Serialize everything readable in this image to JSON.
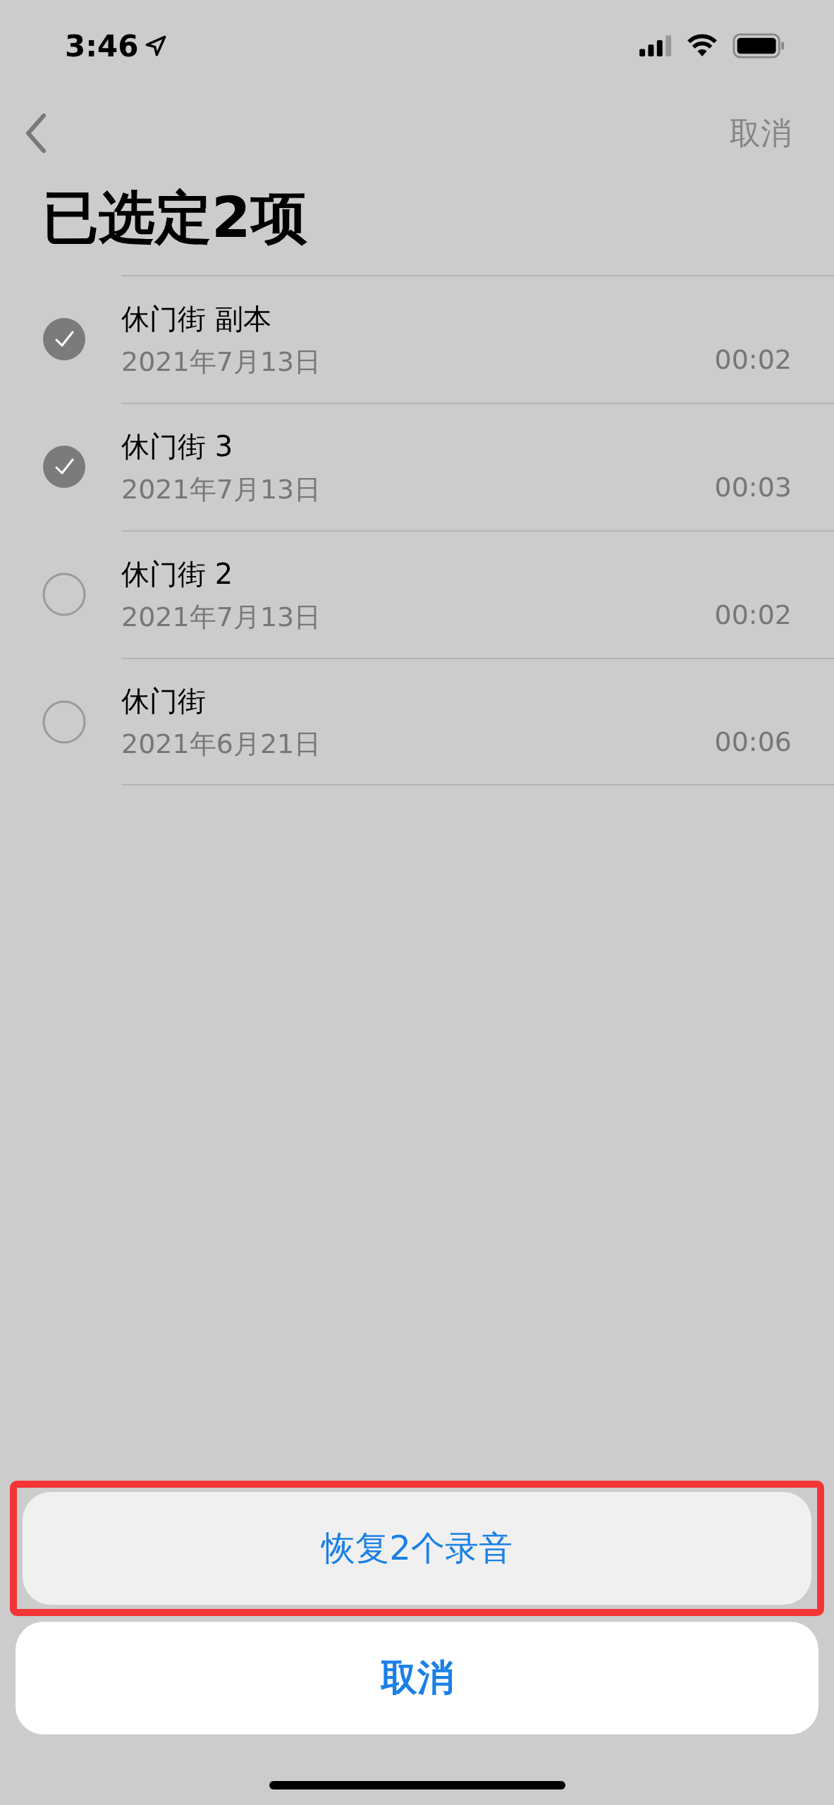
{
  "status_bar": {
    "time": "3:46"
  },
  "nav": {
    "cancel": "取消"
  },
  "title": "已选定2项",
  "recordings": [
    {
      "name": "休门街 副本",
      "date": "2021年7月13日",
      "duration": "00:02",
      "selected": true
    },
    {
      "name": "休门街 3",
      "date": "2021年7月13日",
      "duration": "00:03",
      "selected": true
    },
    {
      "name": "休门街 2",
      "date": "2021年7月13日",
      "duration": "00:02",
      "selected": false
    },
    {
      "name": "休门街",
      "date": "2021年6月21日",
      "duration": "00:06",
      "selected": false
    }
  ],
  "action_sheet": {
    "restore": "恢复2个录音",
    "cancel": "取消"
  }
}
